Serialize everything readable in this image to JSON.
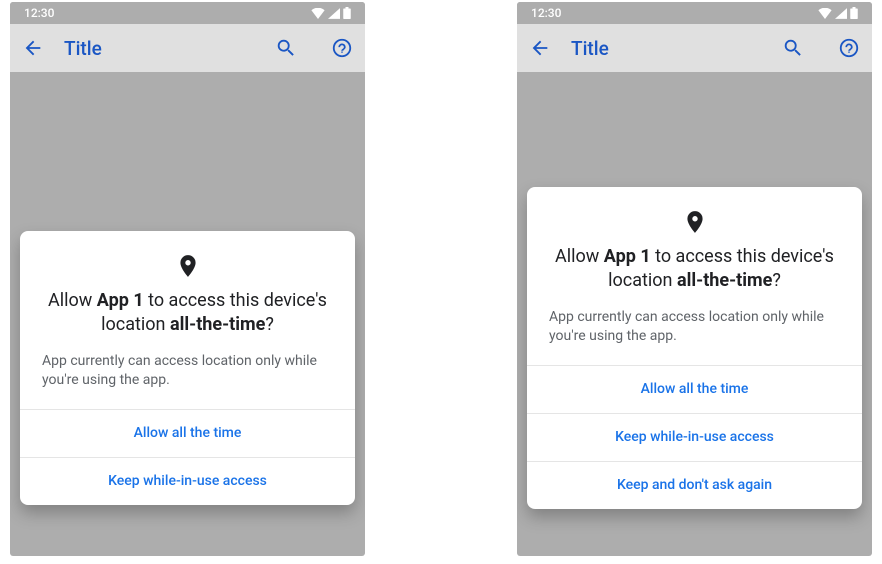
{
  "status": {
    "time": "12:30"
  },
  "appbar": {
    "title": "Title"
  },
  "left_dialog": {
    "title_prefix": "Allow ",
    "app_name": "App 1",
    "title_mid": " to access this device's location ",
    "emph": "all-the-time",
    "q": "?",
    "subtitle": "App currently can access location only while you're using the app.",
    "buttons": [
      "Allow all the time",
      "Keep while-in-use access"
    ]
  },
  "right_dialog": {
    "title_prefix": "Allow ",
    "app_name": "App 1",
    "title_mid": " to access this device's location ",
    "emph": "all-the-time",
    "q": "?",
    "subtitle": "App currently can access location only while you're using the app.",
    "buttons": [
      "Allow all the time",
      "Keep while-in-use access",
      "Keep and don't ask again"
    ]
  }
}
